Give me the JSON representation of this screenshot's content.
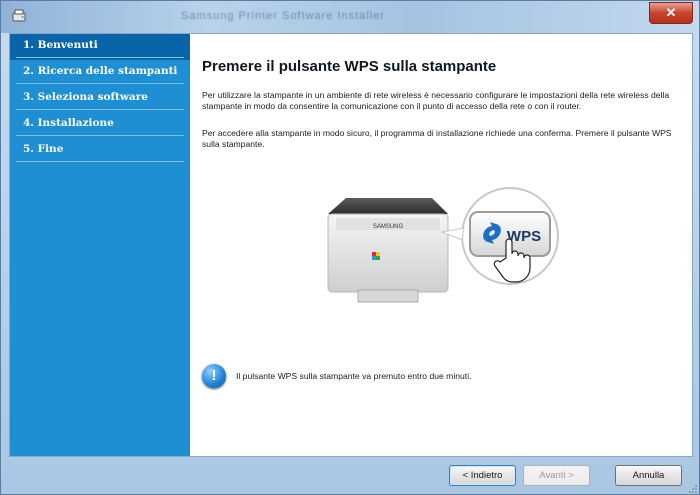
{
  "window": {
    "title": "Samsung Printer Software Installer"
  },
  "sidebar": {
    "items": [
      {
        "label": "1. Benvenuti",
        "active": true
      },
      {
        "label": "2. Ricerca delle stampanti",
        "active": false
      },
      {
        "label": "3. Seleziona software",
        "active": false
      },
      {
        "label": "4. Installazione",
        "active": false
      },
      {
        "label": "5. Fine",
        "active": false
      }
    ]
  },
  "main": {
    "heading": "Premere il pulsante WPS sulla stampante",
    "paragraph1": "Per utilizzare la stampante in un ambiente di rete wireless è necessario configurare le impostazioni della rete wireless della stampante in modo da consentire la comunicazione con il punto di accesso della rete o con il router.",
    "paragraph2": "Per accedere alla stampante in modo sicuro, il programma di installazione richiede una conferma. Premere il pulsante WPS sulla stampante.",
    "illustration": {
      "printer_brand": "SAMSUNG",
      "wps_label": "WPS"
    },
    "notice": "Il pulsante WPS sulla stampante va premuto entro due minuti."
  },
  "footer": {
    "back_label": "< Indietro",
    "next_label": "Avanti >",
    "cancel_label": "Annulla"
  },
  "colors": {
    "sidebar": "#1e8fd2",
    "sidebar_active": "#0a64a8"
  }
}
